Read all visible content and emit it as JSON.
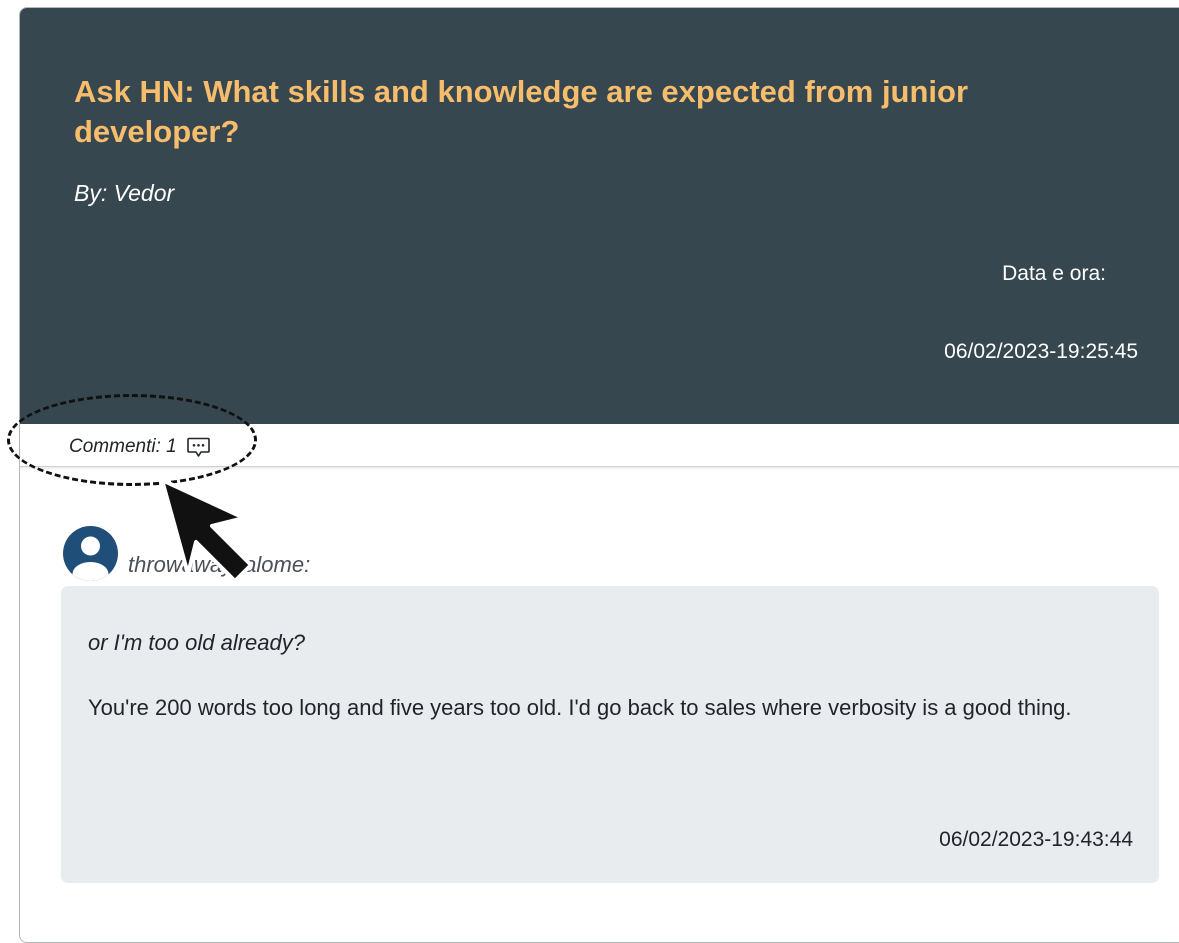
{
  "post": {
    "title": "Ask HN: What skills and knowledge are expected from junior developer?",
    "author": "By: Vedor",
    "date_label": "Data e ora:",
    "date_value": "06/02/2023-19:25:45"
  },
  "comments_bar": {
    "label": "Commenti: 1",
    "icon": "chat-dots-icon"
  },
  "comments": [
    {
      "author": "throwawaysalome:",
      "quote": "or I'm too old already?",
      "text": "You're 200 words too long and five years too old. I'd go back to sales where verbosity is a good thing.",
      "date": "06/02/2023-19:43:44",
      "avatar_icon": "user-avatar-icon"
    }
  ],
  "colors": {
    "header_bg": "#37474f",
    "title_color": "#f6bd6c",
    "comment_bg": "#e9ecef",
    "avatar_color": "#1f4e79"
  }
}
